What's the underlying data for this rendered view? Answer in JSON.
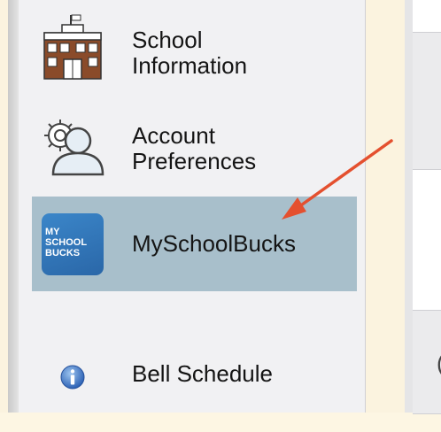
{
  "menu": {
    "items": [
      {
        "id": "school-info",
        "label_line1": "School",
        "label_line2": "Information",
        "icon": "school-building-icon"
      },
      {
        "id": "account-prefs",
        "label_line1": "Account",
        "label_line2": "Preferences",
        "icon": "user-gear-icon"
      },
      {
        "id": "myschoolbucks",
        "label": "MySchoolBucks",
        "icon": "myschoolbucks-logo",
        "selected": true,
        "logo_text": [
          "MY",
          "SCHOOL",
          "BUCKS"
        ]
      },
      {
        "id": "bell-schedule",
        "label": "Bell Schedule",
        "icon": "info-icon"
      }
    ]
  },
  "right_panel": {
    "partial_text": "("
  },
  "colors": {
    "sidebar_bg": "#f1f1f3",
    "selected_bg": "#a8bfcb",
    "page_bg": "#fdf6e3",
    "arrow": "#e4502f",
    "logo_blue": "#2f74b8"
  },
  "annotation": {
    "type": "arrow",
    "points_to": "myschoolbucks"
  }
}
